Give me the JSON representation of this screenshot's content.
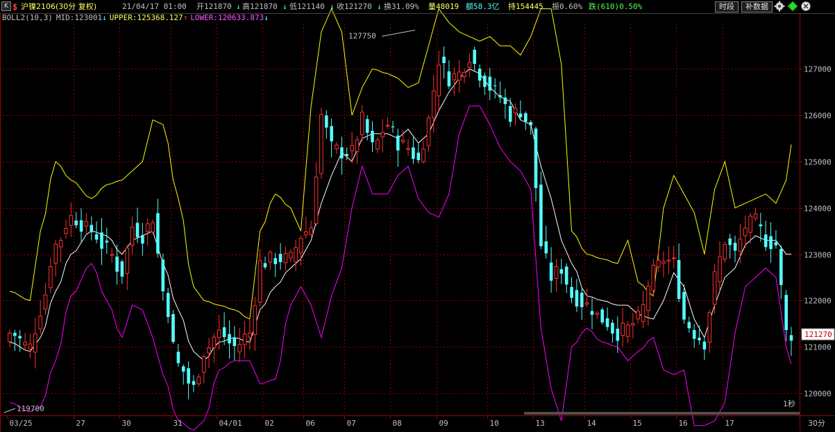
{
  "header": {
    "flag": "$",
    "symbol_period": "沪镍2106(30分 复权)",
    "datetime": "21/04/17 01:00",
    "open": "开121870",
    "open_arrow": "↓",
    "high": "高121870",
    "high_arrow": "↓",
    "low": "低121140",
    "low_arrow": "↓",
    "close": "收121270",
    "close_arrow": "↓",
    "turnover_rate": "换31.09%",
    "volume": "量48019",
    "amount": "额58.3亿",
    "open_interest": "持154445",
    "amplitude": "振0.60%",
    "change": "跌(610)0.50%",
    "buttons": {
      "timeshare": "时段",
      "supplement": "补数据"
    },
    "k_icon": "K",
    "icons": [
      "k-icon",
      "gear-icon",
      "diamond-icon",
      "close-icon"
    ]
  },
  "indicator": {
    "name": "BOLL2(10,3)",
    "mid": "MID:123001",
    "mid_arrow": "↓",
    "upper": "UPPER:125368.127",
    "upper_arrow": "↑",
    "lower": "LOWER:120633.873",
    "lower_arrow": "↓"
  },
  "colors": {
    "up": "#ff3232",
    "down": "#54ffff",
    "upper": "#ffff00",
    "mid": "#ffffff",
    "lower": "#ff00ff",
    "grid": "#8b0000",
    "axis": "#a00000",
    "text": "#c0c0c0",
    "yellow_text": "#ffff66",
    "pink_text": "#ff55ff"
  },
  "chart_data": {
    "type": "candlestick",
    "y_ticks": [
      120000,
      121000,
      122000,
      123000,
      124000,
      125000,
      126000,
      127000
    ],
    "ylim": [
      119520,
      127980
    ],
    "x_labels": [
      {
        "label": "03/25",
        "idx": 0
      },
      {
        "label": "27",
        "idx": 13
      },
      {
        "label": "30",
        "idx": 22
      },
      {
        "label": "31",
        "idx": 32
      },
      {
        "label": "04/01",
        "idx": 41
      },
      {
        "label": "02",
        "idx": 50
      },
      {
        "label": "06",
        "idx": 58
      },
      {
        "label": "07",
        "idx": 66
      },
      {
        "label": "08",
        "idx": 75
      },
      {
        "label": "09",
        "idx": 84
      },
      {
        "label": "10",
        "idx": 94
      },
      {
        "label": "13",
        "idx": 103
      },
      {
        "label": "14",
        "idx": 113
      },
      {
        "label": "15",
        "idx": 122
      },
      {
        "label": "16",
        "idx": 131
      },
      {
        "label": "17",
        "idx": 140
      }
    ],
    "annotations": [
      {
        "text": "127750",
        "value": 127750,
        "idx": 78
      },
      {
        "text": "119700",
        "value": 119700,
        "idx": 0
      }
    ],
    "last_price": "121270",
    "corner_label": "1秒",
    "period_label": "30分",
    "anchors": [
      {
        "i": 0,
        "c": 121300,
        "u": 122200,
        "m": 121100,
        "l": 119800
      },
      {
        "i": 4,
        "c": 121000,
        "u": 122000,
        "m": 120900,
        "l": 119600
      },
      {
        "i": 6,
        "c": 121800,
        "u": 123500,
        "m": 121200,
        "l": 119700
      },
      {
        "i": 9,
        "c": 123200,
        "u": 125000,
        "m": 122200,
        "l": 120700
      },
      {
        "i": 12,
        "c": 123800,
        "u": 124600,
        "m": 123000,
        "l": 122100
      },
      {
        "i": 16,
        "c": 123500,
        "u": 124200,
        "m": 123500,
        "l": 122800
      },
      {
        "i": 19,
        "c": 123100,
        "u": 124500,
        "m": 123400,
        "l": 122000
      },
      {
        "i": 22,
        "c": 122600,
        "u": 124600,
        "m": 123000,
        "l": 121200
      },
      {
        "i": 24,
        "c": 123600,
        "u": 124800,
        "m": 123300,
        "l": 121900
      },
      {
        "i": 26,
        "c": 123400,
        "u": 125000,
        "m": 123400,
        "l": 121800
      },
      {
        "i": 28,
        "c": 123800,
        "u": 125900,
        "m": 123500,
        "l": 121200
      },
      {
        "i": 30,
        "c": 122200,
        "u": 125800,
        "m": 122800,
        "l": 120400
      },
      {
        "i": 33,
        "c": 120600,
        "u": 124200,
        "m": 121800,
        "l": 119400
      },
      {
        "i": 36,
        "c": 120100,
        "u": 122300,
        "m": 120900,
        "l": 119200
      },
      {
        "i": 38,
        "c": 120900,
        "u": 122000,
        "m": 120700,
        "l": 119400
      },
      {
        "i": 41,
        "c": 121300,
        "u": 121900,
        "m": 121100,
        "l": 120500
      },
      {
        "i": 44,
        "c": 121000,
        "u": 121800,
        "m": 121200,
        "l": 120700
      },
      {
        "i": 47,
        "c": 121300,
        "u": 121600,
        "m": 121100,
        "l": 120700
      },
      {
        "i": 49,
        "c": 122800,
        "u": 123500,
        "m": 121800,
        "l": 120200
      },
      {
        "i": 52,
        "c": 122900,
        "u": 124300,
        "m": 122300,
        "l": 120300
      },
      {
        "i": 55,
        "c": 122900,
        "u": 124000,
        "m": 122700,
        "l": 121900
      },
      {
        "i": 57,
        "c": 123400,
        "u": 123500,
        "m": 122900,
        "l": 122300
      },
      {
        "i": 59,
        "c": 123600,
        "u": 126200,
        "m": 123300,
        "l": 121900
      },
      {
        "i": 61,
        "c": 126000,
        "u": 127800,
        "m": 124100,
        "l": 121200
      },
      {
        "i": 63,
        "c": 125300,
        "u": 128300,
        "m": 124700,
        "l": 122100
      },
      {
        "i": 65,
        "c": 125200,
        "u": 127800,
        "m": 125200,
        "l": 122700
      },
      {
        "i": 67,
        "c": 125200,
        "u": 126000,
        "m": 125000,
        "l": 124000
      },
      {
        "i": 69,
        "c": 125900,
        "u": 126600,
        "m": 125500,
        "l": 124900
      },
      {
        "i": 71,
        "c": 125300,
        "u": 127000,
        "m": 125600,
        "l": 124300
      },
      {
        "i": 74,
        "c": 125800,
        "u": 126900,
        "m": 125600,
        "l": 124300
      },
      {
        "i": 76,
        "c": 125400,
        "u": 126800,
        "m": 125500,
        "l": 124700
      },
      {
        "i": 78,
        "c": 125300,
        "u": 126600,
        "m": 125700,
        "l": 124900
      },
      {
        "i": 80,
        "c": 125000,
        "u": 126700,
        "m": 125400,
        "l": 124200
      },
      {
        "i": 82,
        "c": 125900,
        "u": 127500,
        "m": 125600,
        "l": 123900
      },
      {
        "i": 84,
        "c": 127200,
        "u": 128300,
        "m": 126100,
        "l": 123800
      },
      {
        "i": 86,
        "c": 126800,
        "u": 128000,
        "m": 126500,
        "l": 124300
      },
      {
        "i": 88,
        "c": 126900,
        "u": 127800,
        "m": 126800,
        "l": 125600
      },
      {
        "i": 90,
        "c": 127300,
        "u": 127700,
        "m": 127000,
        "l": 126200
      },
      {
        "i": 92,
        "c": 126900,
        "u": 127600,
        "m": 126900,
        "l": 126200
      },
      {
        "i": 94,
        "c": 126600,
        "u": 127700,
        "m": 126600,
        "l": 125800
      },
      {
        "i": 96,
        "c": 126400,
        "u": 127500,
        "m": 126400,
        "l": 125300
      },
      {
        "i": 98,
        "c": 126000,
        "u": 127500,
        "m": 126300,
        "l": 125000
      },
      {
        "i": 100,
        "c": 126100,
        "u": 127300,
        "m": 125900,
        "l": 124800
      },
      {
        "i": 102,
        "c": 125700,
        "u": 127700,
        "m": 125800,
        "l": 124400
      },
      {
        "i": 104,
        "c": 123200,
        "u": 128300,
        "m": 124900,
        "l": 121400
      },
      {
        "i": 106,
        "c": 122500,
        "u": 128300,
        "m": 124200,
        "l": 120100
      },
      {
        "i": 108,
        "c": 122700,
        "u": 127100,
        "m": 123300,
        "l": 119400
      },
      {
        "i": 110,
        "c": 122100,
        "u": 123500,
        "m": 122800,
        "l": 121000
      },
      {
        "i": 113,
        "c": 121900,
        "u": 123000,
        "m": 122100,
        "l": 121400
      },
      {
        "i": 116,
        "c": 121600,
        "u": 122900,
        "m": 122000,
        "l": 121100
      },
      {
        "i": 119,
        "c": 121300,
        "u": 122800,
        "m": 121900,
        "l": 121000
      },
      {
        "i": 121,
        "c": 121400,
        "u": 123300,
        "m": 121900,
        "l": 120700
      },
      {
        "i": 123,
        "c": 121600,
        "u": 122400,
        "m": 121700,
        "l": 120900
      },
      {
        "i": 126,
        "c": 122600,
        "u": 122100,
        "m": 121600,
        "l": 121200
      },
      {
        "i": 128,
        "c": 122900,
        "u": 124000,
        "m": 122000,
        "l": 120500
      },
      {
        "i": 130,
        "c": 122800,
        "u": 124700,
        "m": 122600,
        "l": 120400
      },
      {
        "i": 132,
        "c": 121600,
        "u": 124300,
        "m": 122300,
        "l": 120500
      },
      {
        "i": 134,
        "c": 121300,
        "u": 123900,
        "m": 121600,
        "l": 119300
      },
      {
        "i": 136,
        "c": 121100,
        "u": 123000,
        "m": 121200,
        "l": 119300
      },
      {
        "i": 138,
        "c": 122500,
        "u": 124400,
        "m": 121900,
        "l": 119400
      },
      {
        "i": 140,
        "c": 123300,
        "u": 125000,
        "m": 122500,
        "l": 119800
      },
      {
        "i": 142,
        "c": 123000,
        "u": 124000,
        "m": 122700,
        "l": 121300
      },
      {
        "i": 144,
        "c": 123600,
        "u": 124100,
        "m": 123200,
        "l": 122300
      },
      {
        "i": 146,
        "c": 123700,
        "u": 124200,
        "m": 123400,
        "l": 122500
      },
      {
        "i": 148,
        "c": 123300,
        "u": 124300,
        "m": 123300,
        "l": 122700
      },
      {
        "i": 150,
        "c": 123200,
        "u": 124100,
        "m": 123300,
        "l": 122500
      },
      {
        "i": 152,
        "c": 121300,
        "u": 124600,
        "m": 123000,
        "l": 121000
      },
      {
        "i": 153,
        "c": 121270,
        "u": 125368,
        "m": 123001,
        "l": 120634
      }
    ]
  }
}
